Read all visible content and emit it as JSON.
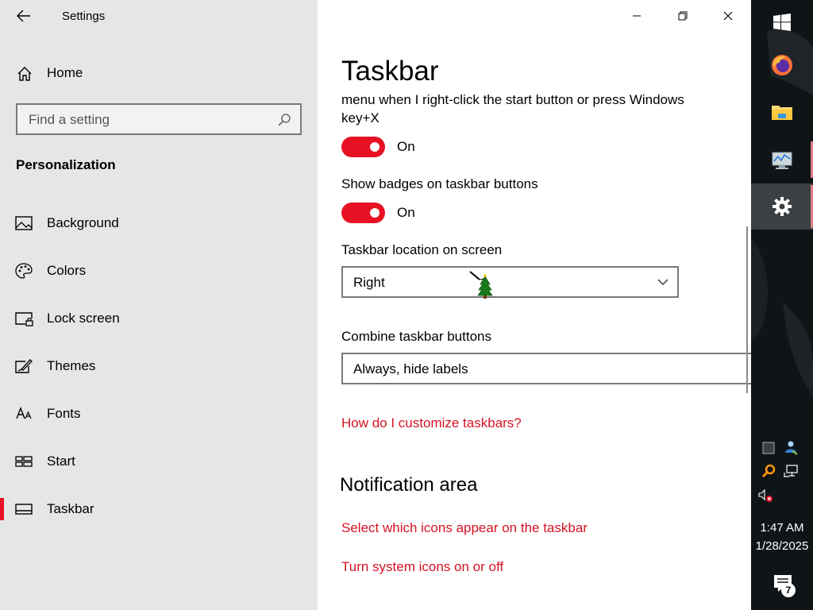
{
  "sidebar": {
    "app_title": "Settings",
    "home_label": "Home",
    "search_placeholder": "Find a setting",
    "section_heading": "Personalization",
    "items": [
      {
        "label": "Background",
        "icon": "picture-icon"
      },
      {
        "label": "Colors",
        "icon": "palette-icon"
      },
      {
        "label": "Lock screen",
        "icon": "lock-screen-icon"
      },
      {
        "label": "Themes",
        "icon": "themes-icon"
      },
      {
        "label": "Fonts",
        "icon": "fonts-icon"
      },
      {
        "label": "Start",
        "icon": "start-icon"
      },
      {
        "label": "Taskbar",
        "icon": "taskbar-icon",
        "active": true
      }
    ]
  },
  "main": {
    "title": "Taskbar",
    "desc_line1": "menu when I right-click the start button or press Windows",
    "desc_line2": "key+X",
    "toggle1_state": "On",
    "badges_label": "Show badges on taskbar buttons",
    "toggle2_state": "On",
    "location_label": "Taskbar location on screen",
    "location_value": "Right",
    "combine_label": "Combine taskbar buttons",
    "combine_value": "Always, hide labels",
    "help_link": "How do I customize taskbars?",
    "notification_heading": "Notification area",
    "link_icons": "Select which icons appear on the taskbar",
    "link_system_icons": "Turn system icons on or off"
  },
  "taskbar": {
    "clock_time": "1:47 AM",
    "clock_date": "1/28/2025",
    "notification_count": "7",
    "apps": [
      "windows-start-icon",
      "firefox-icon",
      "file-explorer-icon",
      "performance-monitor-icon",
      "settings-gear-icon"
    ]
  },
  "colors": {
    "accent": "#e81123",
    "link": "#d41323",
    "sidebar_bg": "#e6e6e6",
    "taskbar_bg": "#0f1417"
  }
}
